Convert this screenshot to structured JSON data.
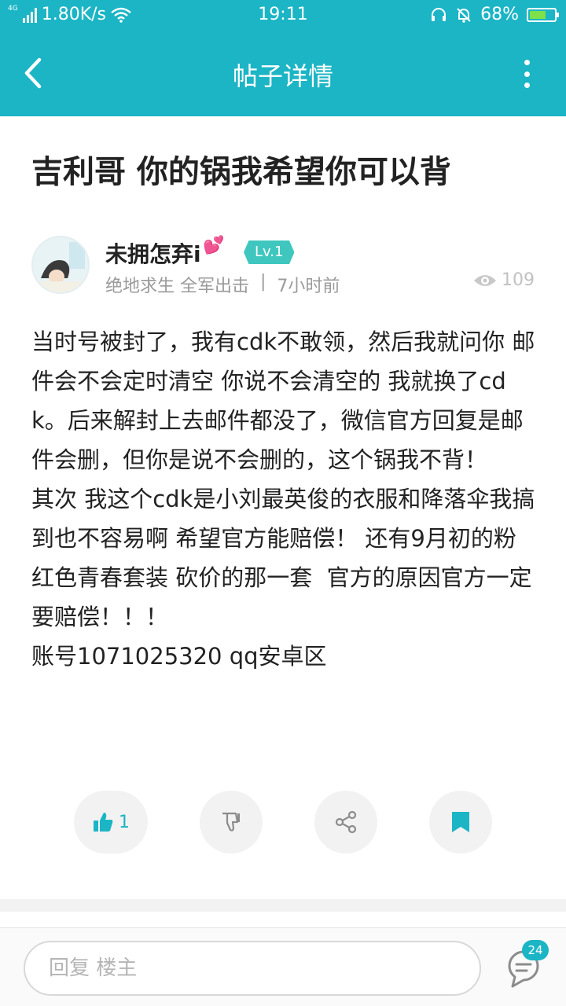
{
  "status_bar": {
    "network_type": "4G",
    "net_speed": "1.80K/s",
    "time": "19:11",
    "battery_percent": "68%",
    "battery_level": 0.68
  },
  "app_bar": {
    "title": "帖子详情"
  },
  "post": {
    "title": "吉利哥 你的锅我希望你可以背",
    "author": "未拥怎弃i",
    "level": "Lv.1",
    "game": "绝地求生 全军出击",
    "separator": "|",
    "time_ago": "7小时前",
    "views": "109",
    "content": "当时号被封了，我有cdk不敢领，然后我就问你 邮件会不会定时清空 你说不会清空的 我就换了cdk。后来解封上去邮件都没了，微信官方回复是邮件会删，但你是说不会删的，这个锅我不背！\n其次 我这个cdk是小刘最英俊的衣服和降落伞我搞到也不容易啊 希望官方能赔偿！ 还有9月初的粉红色青春套装 砍价的那一套  官方的原因官方一定要赔偿！！！\n账号1071025320 qq安卓区"
  },
  "actions": {
    "like_count": "1"
  },
  "bottom_bar": {
    "reply_placeholder": "回复  楼主",
    "comment_count": "24"
  },
  "colors": {
    "accent": "#1bb5c5",
    "level_badge": "#3fc7bf"
  }
}
